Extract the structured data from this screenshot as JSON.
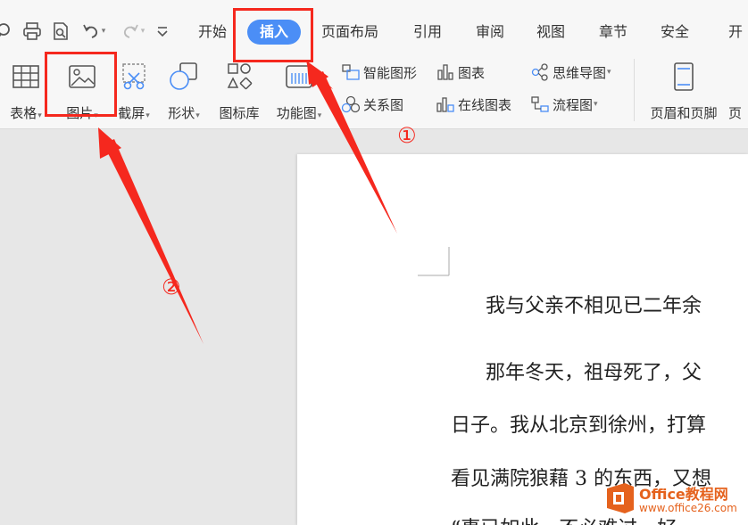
{
  "tabs": {
    "start": "开始",
    "insert": "插入",
    "layout": "页面布局",
    "references": "引用",
    "review": "审阅",
    "view": "视图",
    "section": "章节",
    "security": "安全",
    "more": "开"
  },
  "ribbon": {
    "table": "表格",
    "picture": "图片",
    "screenshot": "截屏",
    "shape": "形状",
    "icon_library": "图标库",
    "function_chart": "功能图",
    "smart_art": "智能图形",
    "chart": "图表",
    "relation_chart": "关系图",
    "online_chart": "在线图表",
    "mind_map": "思维导图",
    "flowchart": "流程图",
    "header_footer": "页眉和页脚",
    "page_cut": "页"
  },
  "document": {
    "line1": "我与父亲不相见已二年余",
    "line2": "那年冬天，祖母死了，父",
    "line3": "日子。我从北京到徐州，打算",
    "line4": "看见满院狼藉 3 的东西，又想",
    "line5": "“事已如此，不必难过，好"
  },
  "annotations": {
    "step1": "①",
    "step2": "②"
  },
  "watermark": {
    "title": "Office教程网",
    "url": "www.office26.com"
  },
  "colors": {
    "accent_blue": "#4b8ef6",
    "annotation_red": "#f5281e",
    "watermark_orange": "#e5621d"
  }
}
